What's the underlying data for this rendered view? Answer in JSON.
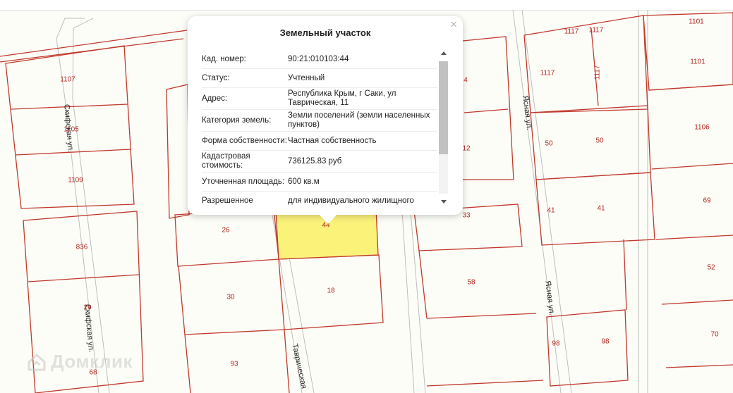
{
  "map": {
    "plots": [
      {
        "num": "1107"
      },
      {
        "num": "1105"
      },
      {
        "num": "1109"
      },
      {
        "num": "836"
      },
      {
        "num": "29"
      },
      {
        "num": "68"
      },
      {
        "num": "26"
      },
      {
        "num": "30"
      },
      {
        "num": "93"
      },
      {
        "num": "44"
      },
      {
        "num": "18"
      },
      {
        "num": "4"
      },
      {
        "num": "12"
      },
      {
        "num": "33"
      },
      {
        "num": "58"
      },
      {
        "num": "1117"
      },
      {
        "num": "1117"
      },
      {
        "num": "1117"
      },
      {
        "num": "1117"
      },
      {
        "num": "50"
      },
      {
        "num": "50"
      },
      {
        "num": "41"
      },
      {
        "num": "41"
      },
      {
        "num": "98"
      },
      {
        "num": "98"
      },
      {
        "num": "1101"
      },
      {
        "num": "1101"
      },
      {
        "num": "1106"
      },
      {
        "num": "69"
      },
      {
        "num": "52"
      },
      {
        "num": "70"
      }
    ],
    "streets": [
      {
        "name": "Скифская ул."
      },
      {
        "name": "Скифская ул."
      },
      {
        "name": "Ясная ул."
      },
      {
        "name": "Ясная ул."
      },
      {
        "name": "Таврическая"
      }
    ],
    "highlight_color": "#fbf27a",
    "boundary_color": "#c0392b"
  },
  "logo": {
    "text": "Домклик"
  },
  "popup": {
    "title": "Земельный участок",
    "close": "×",
    "rows": [
      {
        "label": "Кад. номер:",
        "value": "90:21:010103:44"
      },
      {
        "label": "Статус:",
        "value": "Учтенный"
      },
      {
        "label": "Адрес:",
        "value": "Республика Крым, г Саки, ул Таврическая, 11"
      },
      {
        "label": "Категория земель:",
        "value": "Земли поселений (земли населенных пунктов)"
      },
      {
        "label": "Форма собственности:",
        "value": "Частная собственность"
      },
      {
        "label": "Кадастровая стоимость:",
        "value": "736125.83 руб"
      },
      {
        "label": "Уточненная площадь:",
        "value": "600 кв.м"
      },
      {
        "label": "Разрешенное",
        "value": "для индивидуального жилищного"
      }
    ]
  }
}
